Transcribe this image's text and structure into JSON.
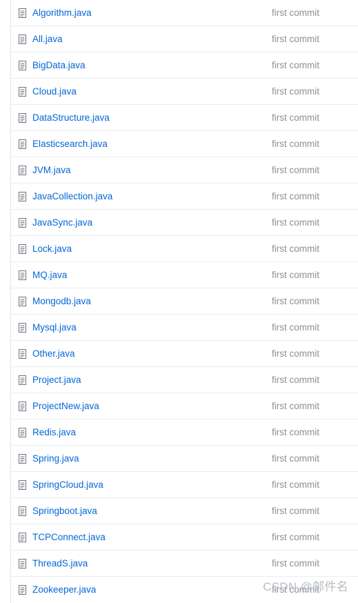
{
  "files": [
    {
      "name": "Algorithm.java",
      "commit": "first commit"
    },
    {
      "name": "All.java",
      "commit": "first commit"
    },
    {
      "name": "BigData.java",
      "commit": "first commit"
    },
    {
      "name": "Cloud.java",
      "commit": "first commit"
    },
    {
      "name": "DataStructure.java",
      "commit": "first commit"
    },
    {
      "name": "Elasticsearch.java",
      "commit": "first commit"
    },
    {
      "name": "JVM.java",
      "commit": "first commit"
    },
    {
      "name": "JavaCollection.java",
      "commit": "first commit"
    },
    {
      "name": "JavaSync.java",
      "commit": "first commit"
    },
    {
      "name": "Lock.java",
      "commit": "first commit"
    },
    {
      "name": "MQ.java",
      "commit": "first commit"
    },
    {
      "name": "Mongodb.java",
      "commit": "first commit"
    },
    {
      "name": "Mysql.java",
      "commit": "first commit"
    },
    {
      "name": "Other.java",
      "commit": "first commit"
    },
    {
      "name": "Project.java",
      "commit": "first commit"
    },
    {
      "name": "ProjectNew.java",
      "commit": "first commit"
    },
    {
      "name": "Redis.java",
      "commit": "first commit"
    },
    {
      "name": "Spring.java",
      "commit": "first commit"
    },
    {
      "name": "SpringCloud.java",
      "commit": "first commit"
    },
    {
      "name": "Springboot.java",
      "commit": "first commit"
    },
    {
      "name": "TCPConnect.java",
      "commit": "first commit"
    },
    {
      "name": "ThreadS.java",
      "commit": "first commit"
    },
    {
      "name": "Zookeeper.java",
      "commit": "first commit"
    }
  ],
  "icon": "file-icon",
  "colors": {
    "link": "#0366d6",
    "muted": "#8a9099",
    "border": "#eaecef",
    "icon": "#6a737d"
  },
  "watermark": "CSDN @邮件名"
}
